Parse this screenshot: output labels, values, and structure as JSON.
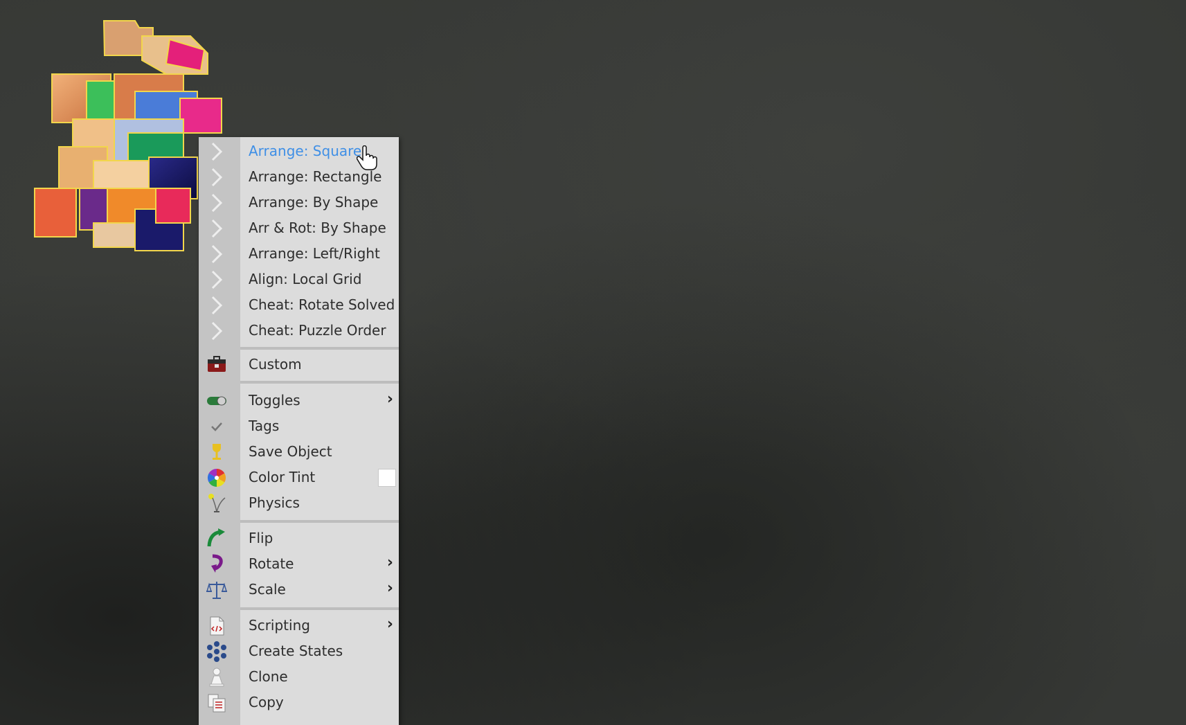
{
  "context_menu": {
    "hovered_item": "Arrange: Square",
    "hover_color": "#3f8fe6",
    "items": [
      {
        "label": "Arrange: Square",
        "icon": "arrow-right-icon"
      },
      {
        "label": "Arrange: Rectangle",
        "icon": "arrow-right-icon"
      },
      {
        "label": "Arrange: By Shape",
        "icon": "arrow-right-icon"
      },
      {
        "label": "Arr & Rot: By Shape",
        "icon": "arrow-right-icon"
      },
      {
        "label": "Arrange: Left/Right",
        "icon": "arrow-right-icon"
      },
      {
        "label": "Align: Local Grid",
        "icon": "arrow-right-icon"
      },
      {
        "label": "Cheat: Rotate Solved",
        "icon": "arrow-right-icon"
      },
      {
        "label": "Cheat: Puzzle Order",
        "icon": "arrow-right-icon"
      },
      {
        "label": "Custom",
        "icon": "toolbox-icon"
      },
      {
        "label": "Toggles",
        "icon": "toggle-icon",
        "submenu": true
      },
      {
        "label": "Tags",
        "icon": "checkmark-icon"
      },
      {
        "label": "Save Object",
        "icon": "trophy-icon"
      },
      {
        "label": "Color Tint",
        "icon": "color-wheel-icon",
        "swatch_color": "#ffffff"
      },
      {
        "label": "Physics",
        "icon": "physics-icon"
      },
      {
        "label": "Flip",
        "icon": "flip-arrow-icon"
      },
      {
        "label": "Rotate",
        "icon": "rotate-arrow-icon",
        "submenu": true
      },
      {
        "label": "Scale",
        "icon": "balance-scale-icon",
        "submenu": true
      },
      {
        "label": "Scripting",
        "icon": "code-document-icon",
        "submenu": true
      },
      {
        "label": "Create States",
        "icon": "states-icon"
      },
      {
        "label": "Clone",
        "icon": "pawn-icon"
      },
      {
        "label": "Copy",
        "icon": "copy-icon"
      }
    ],
    "submenu_indicator": "›"
  }
}
